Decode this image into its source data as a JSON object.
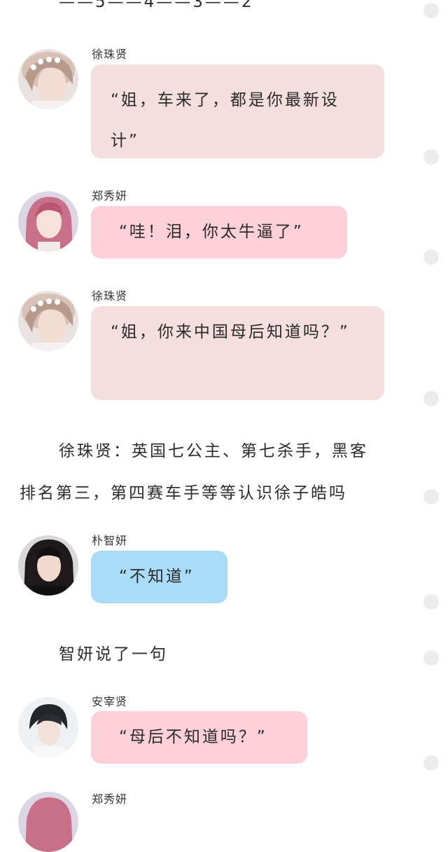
{
  "colors": {
    "bubble_pink": "#f4dede",
    "bubble_rose": "#fdd0da",
    "bubble_blue": "#a9dcf7",
    "scroll_dot": "#ececec"
  },
  "countdown": "——5——4——3——2",
  "messages": [
    {
      "speaker": "徐珠贤",
      "text": "“姐，车来了，都是你最新设计”",
      "avatar": "avatar-seohyun-icon"
    },
    {
      "speaker": "郑秀妍",
      "text": "“哇！泪，你太牛逼了”",
      "avatar": "avatar-jessica-icon"
    },
    {
      "speaker": "徐珠贤",
      "text": "“姐，你来中国母后知道吗？”",
      "avatar": "avatar-seohyun-icon"
    },
    {
      "speaker": "朴智妍",
      "text": "“不知道”",
      "avatar": "avatar-jiyeon-icon"
    },
    {
      "speaker": "安宰贤",
      "text": "“母后不知道吗？”",
      "avatar": "avatar-jaehyun-icon"
    },
    {
      "speaker": "郑秀妍"
    }
  ],
  "narration": {
    "line1": "徐珠贤：英国七公主、第七杀手，黑客",
    "line2": "排名第三，第四赛车手等等认识徐子皓吗",
    "line3": "智妍说了一句"
  }
}
